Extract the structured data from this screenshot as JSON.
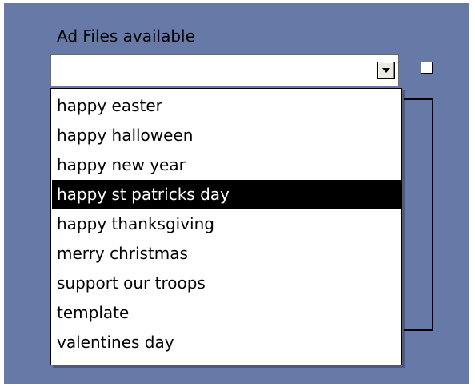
{
  "panel": {
    "label": "Ad Files available"
  },
  "combo": {
    "value": "",
    "arrow_icon": "chevron-down-icon"
  },
  "checkbox": {
    "checked": false
  },
  "dropdown": {
    "options": [
      "happy easter",
      "happy halloween",
      "happy new year",
      "happy st patricks day",
      "happy thanksgiving",
      "merry christmas",
      "support our troops",
      "template",
      "valentines day"
    ],
    "highlighted": "happy st patricks day"
  },
  "colors": {
    "panel_bg": "#6779a6",
    "highlight_bg": "#000000",
    "highlight_text": "#ffffff"
  }
}
